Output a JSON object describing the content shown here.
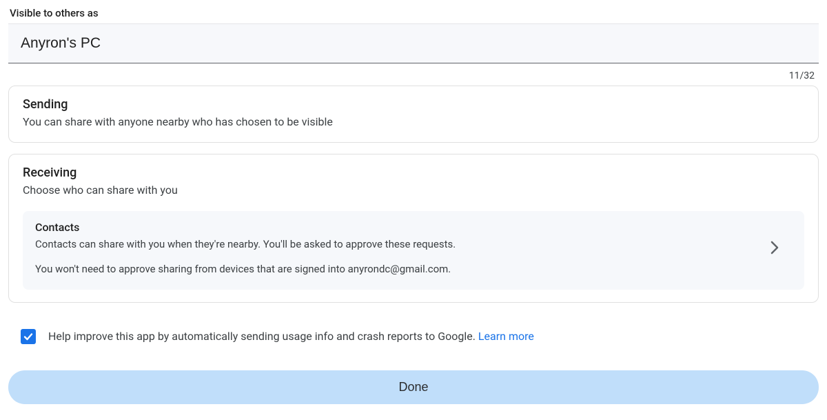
{
  "deviceName": {
    "label": "Visible to others as",
    "value": "Anyron's PC",
    "counter": "11/32"
  },
  "sending": {
    "title": "Sending",
    "description": "You can share with anyone nearby who has chosen to be visible"
  },
  "receiving": {
    "title": "Receiving",
    "description": "Choose who can share with you",
    "option": {
      "title": "Contacts",
      "line1": "Contacts can share with you when they're nearby. You'll be asked to approve these requests.",
      "line2": "You won't need to approve sharing from devices that are signed into anyrondc@gmail.com."
    }
  },
  "improve": {
    "checked": true,
    "text": "Help improve this app by automatically sending usage info and crash reports to Google. ",
    "learnMore": "Learn more"
  },
  "doneLabel": "Done"
}
